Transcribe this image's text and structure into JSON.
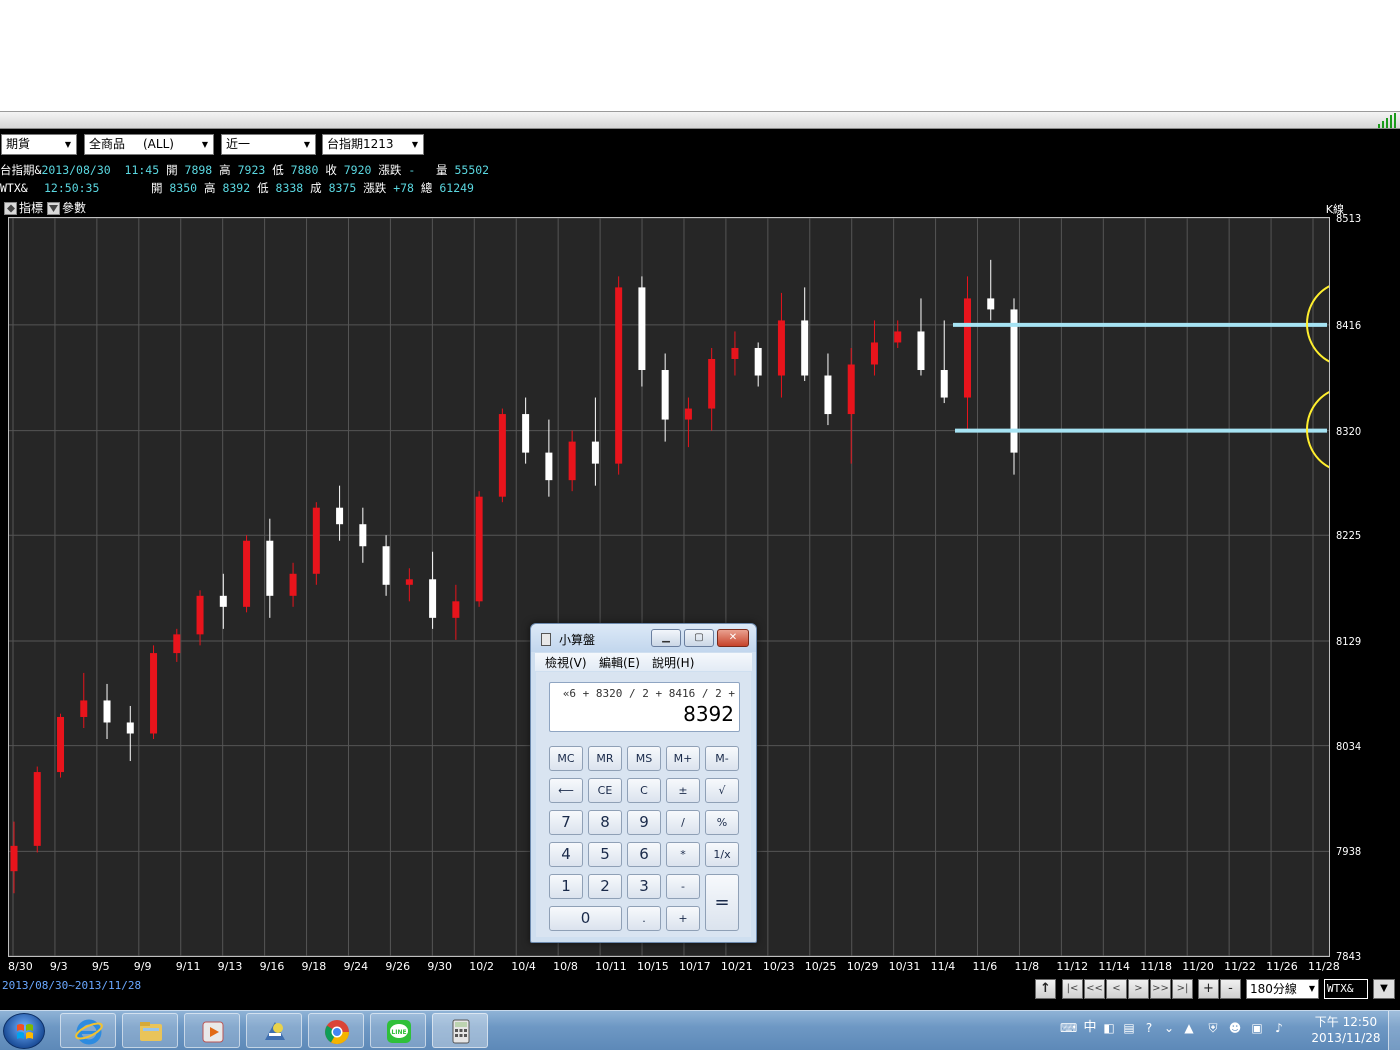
{
  "toolbar": {
    "market": "期貨",
    "product": "全商品",
    "product_extra": "(ALL)",
    "period": "近一",
    "contract": "台指期1213"
  },
  "info": {
    "row1": {
      "name": "台指期&",
      "datetime": "2013/08/30  11:45",
      "open_label": "開",
      "open": "7898",
      "high_label": "高",
      "high": "7923",
      "low_label": "低",
      "low": "7880",
      "close_label": "收",
      "close": "7920",
      "chg_label": "漲跌",
      "chg": "-",
      "vol_label": "量",
      "vol": "55502"
    },
    "row2": {
      "name": "WTX&",
      "time": "12:50:35",
      "open_label": "開",
      "open": "8350",
      "high_label": "高",
      "high": "8392",
      "low_label": "低",
      "low": "8338",
      "last_label": "成",
      "last": "8375",
      "chg_label": "漲跌",
      "chg": "+78",
      "total_label": "總",
      "total": "61249"
    }
  },
  "indicator_bar": {
    "indicator": "指標",
    "params": "參數"
  },
  "chart_label": "K線",
  "range_label": "2013/08/30~2013/11/28",
  "timeframe": "180分線",
  "symbol": "WTX&",
  "colors": {
    "up": "#e8141c",
    "down": "#ffffff",
    "grid": "#555555",
    "hline": "#a6e3f3",
    "circle": "#ffef2e",
    "bg": "#262626"
  },
  "chart_data": {
    "type": "candlestick",
    "ylim": [
      7843,
      8513
    ],
    "y_ticks": [
      "8513",
      "8416",
      "8320",
      "8225",
      "8129",
      "8034",
      "7938",
      "7843"
    ],
    "y_tick_values": [
      8513,
      8416,
      8320,
      8225,
      8129,
      8034,
      7938,
      7843
    ],
    "x_ticks": [
      "8/30",
      "9/3",
      "9/5",
      "9/9",
      "9/11",
      "9/13",
      "9/16",
      "9/18",
      "9/24",
      "9/26",
      "9/30",
      "10/2",
      "10/4",
      "10/8",
      "10/11",
      "10/15",
      "10/17",
      "10/21",
      "10/23",
      "10/25",
      "10/29",
      "10/31",
      "11/4",
      "11/6",
      "11/8",
      "11/12",
      "11/14",
      "11/18",
      "11/20",
      "11/22",
      "11/26",
      "11/28"
    ],
    "candles": [
      [
        7920,
        7965,
        7900,
        7943
      ],
      [
        7943,
        8015,
        7937,
        8010
      ],
      [
        8010,
        8063,
        8005,
        8060
      ],
      [
        8060,
        8100,
        8050,
        8075
      ],
      [
        8075,
        8090,
        8040,
        8055
      ],
      [
        8055,
        8070,
        8020,
        8045
      ],
      [
        8045,
        8125,
        8040,
        8118
      ],
      [
        8118,
        8140,
        8110,
        8135
      ],
      [
        8135,
        8175,
        8125,
        8170
      ],
      [
        8170,
        8190,
        8140,
        8160
      ],
      [
        8160,
        8225,
        8155,
        8220
      ],
      [
        8220,
        8240,
        8150,
        8170
      ],
      [
        8170,
        8200,
        8160,
        8190
      ],
      [
        8190,
        8255,
        8180,
        8250
      ],
      [
        8250,
        8270,
        8220,
        8235
      ],
      [
        8235,
        8250,
        8200,
        8215
      ],
      [
        8215,
        8225,
        8170,
        8180
      ],
      [
        8180,
        8195,
        8165,
        8185
      ],
      [
        8185,
        8210,
        8140,
        8150
      ],
      [
        8150,
        8180,
        8130,
        8165
      ],
      [
        8165,
        8265,
        8160,
        8260
      ],
      [
        8260,
        8340,
        8255,
        8335
      ],
      [
        8335,
        8350,
        8290,
        8300
      ],
      [
        8300,
        8330,
        8260,
        8275
      ],
      [
        8275,
        8320,
        8265,
        8310
      ],
      [
        8310,
        8350,
        8270,
        8290
      ],
      [
        8290,
        8460,
        8280,
        8450
      ],
      [
        8450,
        8460,
        8360,
        8375
      ],
      [
        8375,
        8390,
        8310,
        8330
      ],
      [
        8330,
        8350,
        8305,
        8340
      ],
      [
        8340,
        8395,
        8320,
        8385
      ],
      [
        8385,
        8410,
        8370,
        8395
      ],
      [
        8395,
        8400,
        8360,
        8370
      ],
      [
        8370,
        8445,
        8350,
        8420
      ],
      [
        8420,
        8450,
        8365,
        8370
      ],
      [
        8370,
        8390,
        8325,
        8335
      ],
      [
        8335,
        8395,
        8290,
        8380
      ],
      [
        8380,
        8420,
        8370,
        8400
      ],
      [
        8400,
        8420,
        8395,
        8410
      ],
      [
        8410,
        8440,
        8370,
        8375
      ],
      [
        8375,
        8420,
        8345,
        8350
      ],
      [
        8350,
        8460,
        8320,
        8440
      ],
      [
        8440,
        8475,
        8420,
        8430
      ],
      [
        8430,
        8440,
        8280,
        8300
      ]
    ],
    "hlines": [
      8416,
      8320
    ]
  },
  "calculator": {
    "title": "小算盤",
    "menu": [
      "檢視(V)",
      "編輯(E)",
      "說明(H)"
    ],
    "history": "«6 + 8320 / 2 + 8416 / 2 +",
    "value": "8392",
    "keys": {
      "mc": "MC",
      "mr": "MR",
      "ms": "MS",
      "mplus": "M+",
      "mminus": "M-",
      "back": "⟵",
      "ce": "CE",
      "c": "C",
      "pm": "±",
      "sqrt": "√",
      "k7": "7",
      "k8": "8",
      "k9": "9",
      "div": "/",
      "pct": "%",
      "k4": "4",
      "k5": "5",
      "k6": "6",
      "mul": "*",
      "inv": "1/x",
      "k1": "1",
      "k2": "2",
      "k3": "3",
      "sub": "-",
      "eq": "=",
      "k0": "0",
      "dot": ".",
      "add": "+"
    }
  },
  "taskbar": {
    "ime": "中",
    "clock_time": "下午 12:50",
    "clock_date": "2013/11/28"
  }
}
